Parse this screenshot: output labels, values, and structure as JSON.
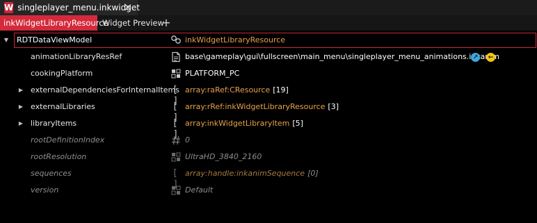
{
  "titlebar": {
    "file_name": "singleplayer_menu.inkwidget",
    "app_icon_letter": "W",
    "close_glyph": "✕"
  },
  "tabs": {
    "active_label": "inkWidgetLibraryResource",
    "second_label": "Widget Preview",
    "add_glyph": "+"
  },
  "root": {
    "name": "RDTDataViewModel",
    "value": "inkWidgetLibraryResource",
    "expander_glyph": "▼",
    "icon": "class-link-icon"
  },
  "properties": [
    {
      "name": "animationLibraryResRef",
      "value": "base\\gameplay\\gui\\fullscreen\\main_menu\\singleplayer_menu_animations.inkanim",
      "icon": "file-icon",
      "expandable": false,
      "muted": false
    },
    {
      "name": "cookingPlatform",
      "value": "PLATFORM_PC",
      "icon": "enum-icon",
      "expandable": false,
      "muted": false
    },
    {
      "name": "externalDependenciesForInternalItems",
      "value": "array:raRef:CResource",
      "count": "[19]",
      "icon": "array-icon",
      "expandable": true,
      "muted": false
    },
    {
      "name": "externalLibraries",
      "value": "array:rRef:inkWidgetLibraryResource",
      "count": "[3]",
      "icon": "array-icon",
      "expandable": true,
      "muted": false
    },
    {
      "name": "libraryItems",
      "value": "array:inkWidgetLibraryItem",
      "count": "[5]",
      "icon": "array-icon",
      "expandable": true,
      "muted": false
    },
    {
      "name": "rootDefinitionIndex",
      "value": "0",
      "icon": "number-icon",
      "expandable": false,
      "muted": true
    },
    {
      "name": "rootResolution",
      "value": "UltraHD_3840_2160",
      "icon": "enum-icon",
      "expandable": false,
      "muted": true
    },
    {
      "name": "sequences",
      "value": "array:handle:inkanimSequence",
      "count": "[0]",
      "icon": "array-icon",
      "expandable": false,
      "muted": true
    },
    {
      "name": "version",
      "value": "Default",
      "icon": "enum-icon",
      "expandable": false,
      "muted": true
    }
  ],
  "glyphs": {
    "expander_collapsed": "▶",
    "open_glyph": "↗",
    "back_glyph": "←"
  },
  "colors": {
    "accent_red": "#d42a3c",
    "type_orange": "#e7a04e",
    "open_blue": "#3fa6e0",
    "back_yellow": "#f2c515"
  }
}
